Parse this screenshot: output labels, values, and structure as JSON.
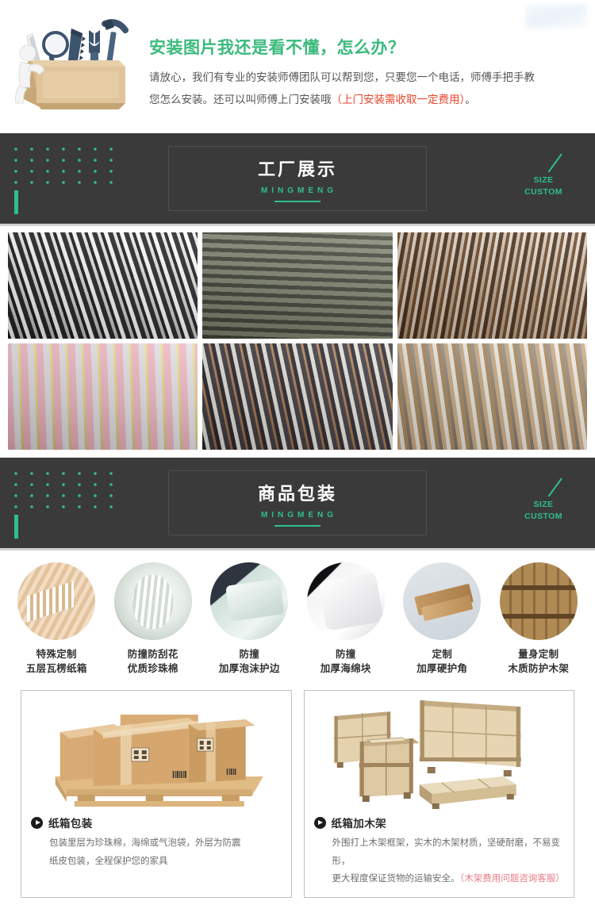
{
  "install": {
    "title": "安装图片我还是看不懂，怎么办？",
    "body_line1": "请放心，我们有专业的安装师傅团队可以帮到您，只要您一个电话，师傅手把手教",
    "body_line2_a": "您怎么安装。还可以叫师傅上门安装哦",
    "body_line2_hl": "（上门安装需收取一定费用）",
    "body_line2_b": "。"
  },
  "banner_factory": {
    "title": "工厂展示",
    "subtitle": "MINGMENG",
    "right_line1": "SIZE",
    "right_line2": "CUSTOM"
  },
  "banner_packaging": {
    "title": "商品包装",
    "subtitle": "MINGMENG",
    "right_line1": "SIZE",
    "right_line2": "CUSTOM"
  },
  "factory_photos": [
    {
      "alt": "black metal chair frames stacked in factory"
    },
    {
      "alt": "worker stacking metal chair frames"
    },
    {
      "alt": "wooden chair frames stacked in warehouse"
    },
    {
      "alt": "colorful chair stock in showroom warehouse"
    },
    {
      "alt": "dark dining chairs lined up on factory floor"
    },
    {
      "alt": "raw unfinished wooden chairs in rows"
    }
  ],
  "packaging_items": [
    {
      "line1": "特殊定制",
      "line2": "五层瓦楞纸箱",
      "image": "corrugated-carton"
    },
    {
      "line1": "防撞防刮花",
      "line2": "优质珍珠棉",
      "image": "pearl-cotton-roll"
    },
    {
      "line1": "防撞",
      "line2": "加厚泡沫护边",
      "image": "foam-edge-protector"
    },
    {
      "line1": "防撞",
      "line2": "加厚海绵块",
      "image": "thick-sponge-block"
    },
    {
      "line1": "定制",
      "line2": "加厚硬护角",
      "image": "hard-corner-protector"
    },
    {
      "line1": "量身定制",
      "line2": "木质防护木架",
      "image": "wooden-protective-crate"
    }
  ],
  "bottom_cards": [
    {
      "title": "纸箱包装",
      "desc_line1": "包装里层为珍珠棉，海绵或气泡袋，外层为防震",
      "desc_line2": "纸皮包装，全程保护您的家具",
      "desc_hl": "",
      "image": "cardboard-boxes-on-pallet"
    },
    {
      "title": "纸箱加木架",
      "desc_line1": "外围打上木架框架，实木的木架材质，坚硬耐磨，不易变形，",
      "desc_line2": "更大程度保证货物的运输安全。",
      "desc_hl": "（木架费用问题咨询客服）",
      "image": "wooden-crates"
    }
  ],
  "colors": {
    "green_accent": "#2ec08a",
    "title_green": "#3aba7c",
    "dark_banner": "#3a3a3a",
    "red_highlight": "#e8452c",
    "pink_highlight": "#e87b86"
  }
}
